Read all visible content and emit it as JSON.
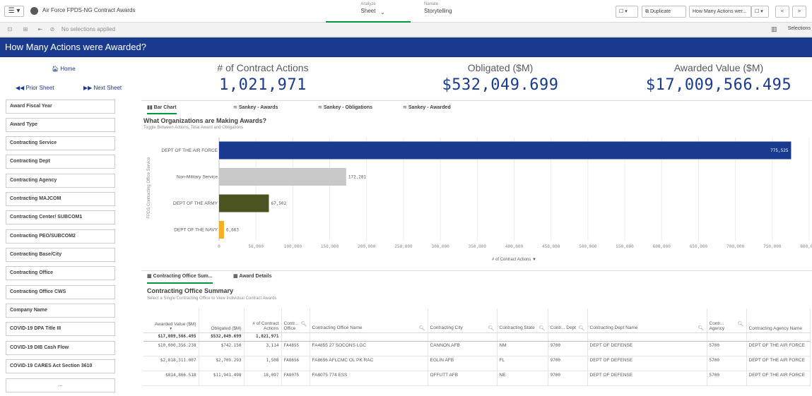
{
  "topbar": {
    "menu": "☰ ▾",
    "app_title": "Air Force FPDS-NG Contract Awards",
    "analyze_caption": "Analyze",
    "analyze_label": "Sheet",
    "narrate_caption": "Narrate",
    "narrate_label": "Storytelling",
    "bookmark": "☐ ▾",
    "duplicate_label": "Duplicate",
    "sheet_select": "How Many Actions wer...",
    "prev": "<",
    "next": ">"
  },
  "selections": {
    "text": "No selections applied",
    "selections_label": "Selections"
  },
  "sheet_title": "How Many Actions were Awarded?",
  "nav": {
    "home": "Home",
    "prior": "Prior Sheet",
    "next": "Next Sheet"
  },
  "filters": [
    "Award Fiscal Year",
    "Award Type",
    "Contracting Service",
    "Contracting Dept",
    "Contracting Agency",
    "Contracting MAJCOM",
    "Contracting Center/ SUBCOM1",
    "Contracting PEO/SUBCOM2",
    "Contracting Base/City",
    "Contracting Office",
    "Contracting Office CWS",
    "Company Name",
    "COVID-19 DPA Title III",
    "COVID-19 DIB Cash Flow",
    "COVID-19 CARES Act Section 3610",
    "..."
  ],
  "kpis": [
    {
      "label": "# of Contract Actions",
      "value": "1,021,971"
    },
    {
      "label": "Obligated ($M)",
      "value": "$532,049.699"
    },
    {
      "label": "Awarded Value ($M)",
      "value": "$17,009,566.495"
    }
  ],
  "chart_tabs": [
    "Bar Chart",
    "Sankey - Awards",
    "Sankey - Obligations",
    "Sankey - Awarded"
  ],
  "chart_title": "What Organizations are Making Awards?",
  "chart_subtitle": "Toggle Between Actions, Total Award and Obligations",
  "chart_data": {
    "type": "bar",
    "orientation": "horizontal",
    "categories": [
      "DEPT OF THE AIR FORCE",
      "Non-Military Service",
      "DEPT OF THE ARMY",
      "DEPT OF THE NAVY"
    ],
    "values": [
      775525,
      172281,
      67502,
      6663
    ],
    "value_labels": [
      "775,525",
      "172,281",
      "67,502",
      "6,663"
    ],
    "colors": [
      "#1a3a8f",
      "#c8c8c8",
      "#4b5320",
      "#f0b323"
    ],
    "xlabel": "# of Contract Actions",
    "ylabel": "FPDS Contracting Office Service",
    "xlim": [
      0,
      800000
    ],
    "xticks": [
      "0",
      "50,000",
      "100,000",
      "150,000",
      "200,000",
      "250,000",
      "300,000",
      "350,000",
      "400,000",
      "450,000",
      "500,000",
      "550,000",
      "600,000",
      "650,000",
      "700,000",
      "750,000",
      "800,000"
    ],
    "grid": true
  },
  "table_tabs": [
    "Contracting Office Sum...",
    "Award Details"
  ],
  "table_title": "Contracting Office Summary",
  "table_subtitle": "Select a Single Contracting Office to View Individual Contract Awards",
  "table": {
    "headers": [
      "Awarded Value ($M)",
      "Obligated ($M)",
      "# of Contract Actions",
      "Contr... Office",
      "Contracting Office Name",
      "Contracting City",
      "Contracting State",
      "Contr... Dept",
      "Contracting Dept Name",
      "Contr... Agency",
      "Contracting Agency Name"
    ],
    "totals": [
      "$17,009,566.495",
      "$532,049.699",
      "1,021,971"
    ],
    "rows": [
      [
        "$10,000,356.238",
        "$742.150",
        "3,114",
        "FA4855",
        "FA4855 27 SOCONS LGC",
        "CANNON AFB",
        "NM",
        "9700",
        "DEPT OF DEFENSE",
        "5700",
        "DEPT OF THE AIR FORCE"
      ],
      [
        "$2,818,311.007",
        "$2,709.293",
        "1,508",
        "FA8656",
        "FA8656 AFLCMC OL PK RAC",
        "EGLIN AFB",
        "FL",
        "9700",
        "DEPT OF DEFENSE",
        "5700",
        "DEPT OF THE AIR FORCE"
      ],
      [
        "$814,866.518",
        "$11,941.498",
        "18,097",
        "FA8075",
        "FA8075 774 ESS",
        "OFFUTT AFB",
        "NE",
        "9700",
        "DEPT OF DEFENSE",
        "5700",
        "DEPT OF THE AIR FORCE"
      ]
    ]
  }
}
